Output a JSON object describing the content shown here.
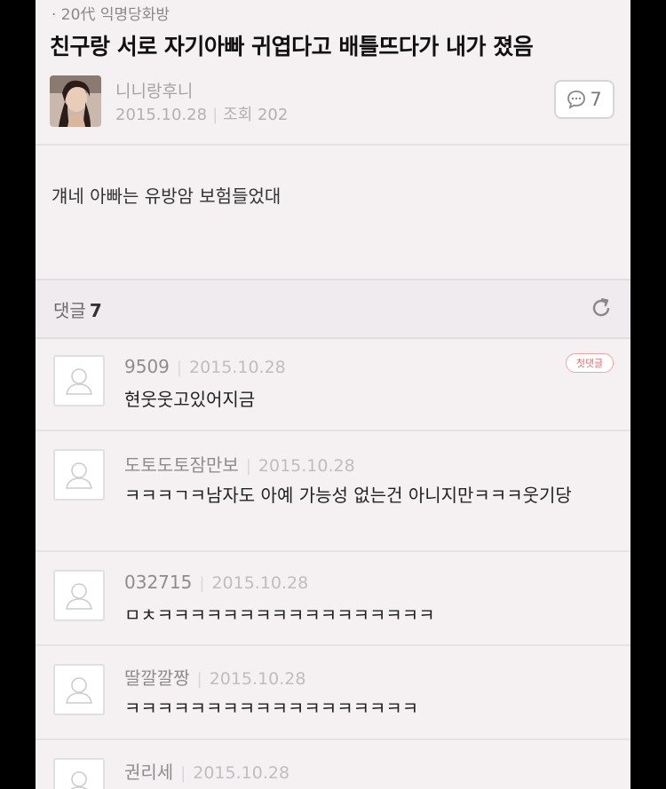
{
  "board": {
    "name": "· 20代 익명당화방"
  },
  "post": {
    "title": "친구랑 서로 자기아빠 귀엽다고 배틀뜨다가 내가 졌음",
    "author": "니니랑후니",
    "date": "2015.10.28",
    "views": "조회 202",
    "comment_count": "7",
    "body": "걔네 아빠는 유방암 보험들었대"
  },
  "comments_section": {
    "label": "댓글",
    "count": "7"
  },
  "comments": [
    {
      "author": "9509",
      "date": "2015.10.28",
      "text": "현웃웃고있어지금",
      "badge": "첫댓글"
    },
    {
      "author": "도토도토잠만보",
      "date": "2015.10.28",
      "text": "ㅋㅋㅋㄱㅋ남자도 아예 가능성 없는건 아니지만ㅋㅋㅋ웃기당"
    },
    {
      "author": "032715",
      "date": "2015.10.28",
      "text": "ㅁㅊㅋㅋㅋㅋㅋㅋㅋㅋㅋㅋㅋㅋㅋㅋㅋㅋㅋ"
    },
    {
      "author": "딸깔깔짱",
      "date": "2015.10.28",
      "text": "ㅋㅋㅋㅋㅋㅋㅋㅋㅋㅋㅋㅋㅋㅋㅋㅋㅋㅋ"
    },
    {
      "author": "권리세",
      "date": "2015.10.28",
      "text": ""
    }
  ],
  "icons": {
    "comment": "speech-bubble-icon",
    "refresh": "refresh-icon",
    "avatar": "default-user-icon"
  },
  "colors": {
    "background": "#f5f1f3",
    "badge": "#ee6767"
  }
}
